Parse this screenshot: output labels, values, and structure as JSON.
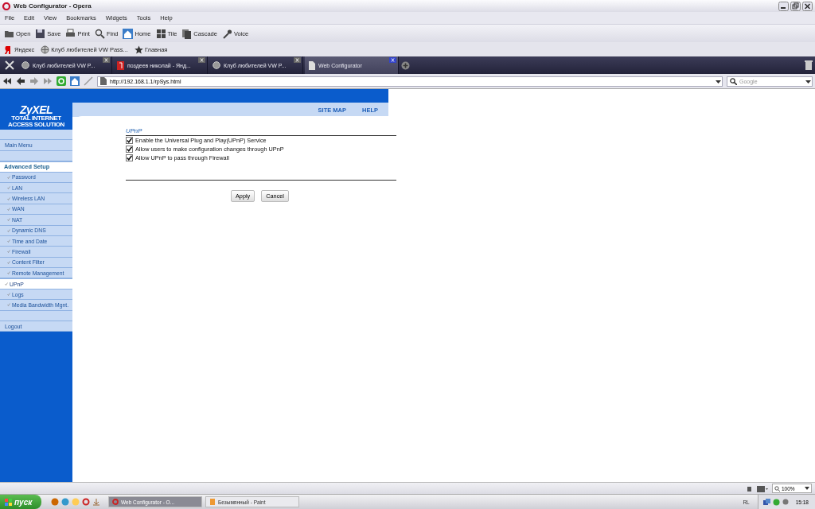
{
  "window": {
    "title": "Web Configurator - Opera"
  },
  "menu": [
    "File",
    "Edit",
    "View",
    "Bookmarks",
    "Widgets",
    "Tools",
    "Help"
  ],
  "toolbar": [
    "Open",
    "Save",
    "Print",
    "Find",
    "Home",
    "Tile",
    "Cascade",
    "Voice"
  ],
  "bookmarks": [
    "Яндекс",
    "Клуб любителей VW Pass...",
    "Главная"
  ],
  "tabs": [
    {
      "label": "Клуб любителей VW P...",
      "selected": false
    },
    {
      "label": "поздеев николай - Янд...",
      "selected": false
    },
    {
      "label": "Клуб любителей VW P...",
      "selected": false
    },
    {
      "label": "Web Configurator",
      "selected": true
    }
  ],
  "address": {
    "url": "http://192.168.1.1/rpSys.html"
  },
  "search": {
    "placeholder": "Google"
  },
  "page": {
    "logo": {
      "name": "ZyXEL",
      "tagline": "TOTAL INTERNET ACCESS SOLUTION"
    },
    "header_links": [
      "SITE MAP",
      "HELP"
    ],
    "sidebar": [
      {
        "label": "Main Menu",
        "kind": "menu",
        "selected": false
      },
      {
        "label": "Advanced Setup",
        "kind": "section",
        "selected": false
      },
      {
        "label": "Password",
        "kind": "item",
        "selected": false
      },
      {
        "label": "LAN",
        "kind": "item",
        "selected": false
      },
      {
        "label": "Wireless LAN",
        "kind": "item",
        "selected": false
      },
      {
        "label": "WAN",
        "kind": "item",
        "selected": false
      },
      {
        "label": "NAT",
        "kind": "item",
        "selected": false
      },
      {
        "label": "Dynamic DNS",
        "kind": "item",
        "selected": false
      },
      {
        "label": "Time and Date",
        "kind": "item",
        "selected": false
      },
      {
        "label": "Firewall",
        "kind": "item",
        "selected": false
      },
      {
        "label": "Content Filter",
        "kind": "item",
        "selected": false
      },
      {
        "label": "Remote Management",
        "kind": "item",
        "selected": false
      },
      {
        "label": "UPnP",
        "kind": "item",
        "selected": true
      },
      {
        "label": "Logs",
        "kind": "item",
        "selected": false
      },
      {
        "label": "Media Bandwidth Mgnt.",
        "kind": "item",
        "selected": false
      },
      {
        "label": "Logout",
        "kind": "menu",
        "selected": false
      }
    ],
    "section_title": "UPnP",
    "options": [
      {
        "label": "Enable the Universal Plug and Play(UPnP) Service",
        "checked": true
      },
      {
        "label": "Allow users to make configuration changes through UPnP",
        "checked": true
      },
      {
        "label": "Allow UPnP to pass through Firewall",
        "checked": true
      }
    ],
    "buttons": [
      "Apply",
      "Cancel"
    ]
  },
  "status_bar": {
    "zoom": "100%"
  },
  "taskbar": {
    "start": "пуск",
    "tasks": [
      {
        "label": "Web Configurator - O...",
        "selected": true
      },
      {
        "label": "Безымянный - Paint",
        "selected": false
      }
    ],
    "language": "RL",
    "clock": "15:18"
  }
}
